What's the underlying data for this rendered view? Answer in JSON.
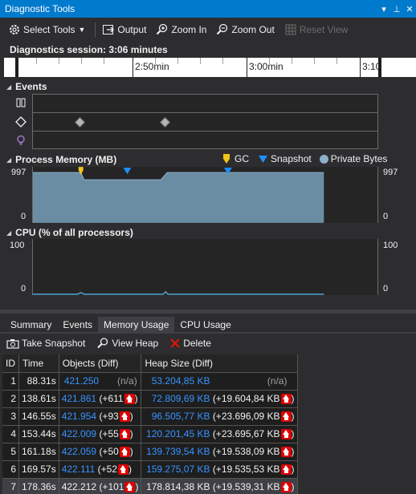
{
  "window": {
    "title": "Diagnostic Tools",
    "buttons": [
      "▾",
      "⊥",
      "✕"
    ]
  },
  "toolbar": {
    "select_tools": "Select Tools",
    "output": "Output",
    "zoom_in": "Zoom In",
    "zoom_out": "Zoom Out",
    "reset_view": "Reset View"
  },
  "session": {
    "label": "Diagnostics session: 3:06 minutes"
  },
  "timeline": {
    "labels": [
      "2:50min",
      "3:00min",
      "3:10"
    ]
  },
  "events": {
    "header": "Events",
    "icons": [
      "pause-icon",
      "breakpoint-diamond-icon",
      "intellitrace-bulb-icon"
    ]
  },
  "memory": {
    "header": "Process Memory (MB)",
    "legend": {
      "gc": "GC",
      "snapshot": "Snapshot",
      "private_bytes": "Private Bytes"
    },
    "ymax": "997",
    "ymin": "0",
    "colors": {
      "gc": "#f0c419",
      "snapshot": "#1e90ff",
      "private_bytes": "#8cb0c8",
      "area": "#6b8da3"
    }
  },
  "cpu": {
    "header": "CPU (% of all processors)",
    "ymax": "100",
    "ymin": "0"
  },
  "tabs": [
    {
      "label": "Summary"
    },
    {
      "label": "Events"
    },
    {
      "label": "Memory Usage"
    },
    {
      "label": "CPU Usage"
    }
  ],
  "memory_tools": {
    "take_snapshot": "Take Snapshot",
    "view_heap": "View Heap",
    "delete": "Delete"
  },
  "table": {
    "columns": [
      "ID",
      "Time",
      "Objects (Diff)",
      "Heap Size (Diff)"
    ],
    "rows": [
      {
        "id": "1",
        "time": "88.31s",
        "objects": "421.250",
        "objects_diff": "(n/a)",
        "heap": "53.204,85 KB",
        "heap_diff": "(n/a)"
      },
      {
        "id": "2",
        "time": "138.61s",
        "objects": "421.861",
        "objects_diff": "(+611",
        "heap": "72.809,69 KB",
        "heap_diff": "(+19.604,84 KB"
      },
      {
        "id": "3",
        "time": "146.55s",
        "objects": "421.954",
        "objects_diff": "(+93",
        "heap": "96.505,77 KB",
        "heap_diff": "(+23.696,09 KB"
      },
      {
        "id": "4",
        "time": "153.44s",
        "objects": "422.009",
        "objects_diff": "(+55",
        "heap": "120.201,45 KB",
        "heap_diff": "(+23.695,67 KB"
      },
      {
        "id": "5",
        "time": "161.18s",
        "objects": "422.059",
        "objects_diff": "(+50",
        "heap": "139.739,54 KB",
        "heap_diff": "(+19.538,09 KB"
      },
      {
        "id": "6",
        "time": "169.57s",
        "objects": "422.111",
        "objects_diff": "(+52",
        "heap": "159.275,07 KB",
        "heap_diff": "(+19.535,53 KB"
      },
      {
        "id": "7",
        "time": "178.36s",
        "objects": "422.212",
        "objects_diff": "(+101",
        "heap": "178.814,38 KB",
        "heap_diff": "(+19.539,31 KB"
      }
    ],
    "close_paren": ")"
  }
}
